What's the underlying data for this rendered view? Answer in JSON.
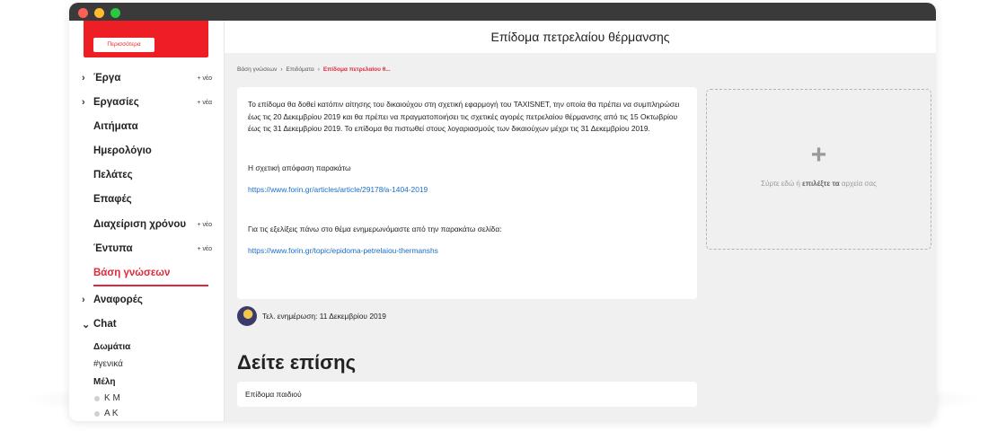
{
  "window": {
    "colors": {
      "close": "#fe5f57",
      "minimize": "#febc2e",
      "maximize": "#28c840"
    }
  },
  "sidebar": {
    "promo": {
      "button_label": "Περισσότερα",
      "color": "#ee1e25"
    },
    "items": [
      {
        "label": "Έργα",
        "chevron": "›",
        "new": "+ νέο"
      },
      {
        "label": "Εργασίες",
        "chevron": "›",
        "new": "+ νέα"
      },
      {
        "label": "Αιτήματα"
      },
      {
        "label": "Ημερολόγιο"
      },
      {
        "label": "Πελάτες"
      },
      {
        "label": "Επαφές"
      },
      {
        "label": "Διαχείριση χρόνου",
        "new": "+ νέο"
      },
      {
        "label": "Έντυπα",
        "new": "+ νέο"
      },
      {
        "label": "Βάση γνώσεων",
        "active": true
      },
      {
        "label": "Αναφορές",
        "chevron": "›"
      },
      {
        "label": "Chat",
        "chevron": "⌄"
      }
    ],
    "chat": {
      "rooms_title": "Δωμάτια",
      "rooms": [
        "#γενικά"
      ],
      "members_title": "Μέλη",
      "members": [
        "Κ Μ",
        "Α Κ"
      ]
    },
    "accent_color": "#e0283b"
  },
  "main": {
    "title": "Επίδομα πετρελαίου θέρμανσης",
    "breadcrumb": {
      "root": "Βάση γνώσεων",
      "sep": "›",
      "parent": "Επιδόματα",
      "current": "Επίδομα πετρελαίου θ..."
    },
    "article": {
      "paragraph1": "Το επίδομα θα δοθεί κατόπιν αίτησης του δικαιούχου στη σχετική εφαρμογή του TAXISNET, την οποία θα πρέπει να συμπληρώσει έως τις 20 Δεκεμβρίου 2019 και θα πρέπει να πραγματοποιήσει τις σχετικές αγορές πετρελαίου θέρμανσης από τις 15 Οκτωβρίου έως τις 31 Δεκεμβρίου 2019. Το επίδομα θα πιστωθεί στους λογαριασμούς των δικαιούχων μέχρι τις 31 Δεκεμβρίου 2019.",
      "decision_label": "Η σχετική απόφαση παρακάτω",
      "decision_link": "https://www.forin.gr/articles/article/29178/a-1404-2019",
      "updates_label": "Για τις εξελίξεις πάνω στο θέμα ενημερωνόμαστε από την παρακάτω σελίδα:",
      "updates_link": "https://www.forin.gr/topic/epidoma-petrelaiou-thermanshs"
    },
    "last_updated": "Τελ. ενημέρωση: 11 Δεκεμβρίου 2019",
    "see_also": {
      "heading": "Δείτε επίσης",
      "items": [
        "Επίδομα παιδιού"
      ]
    },
    "dropzone": {
      "plus": "+",
      "text_before": "Σύρτε εδώ ή ",
      "text_bold": "επιλέξτε τα",
      "text_after": " αρχεία σας"
    },
    "link_color": "#1a6ec8"
  }
}
